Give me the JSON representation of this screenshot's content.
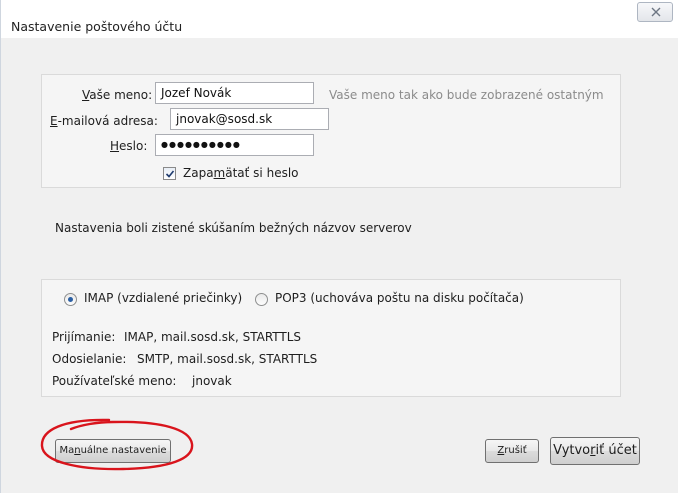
{
  "window": {
    "title": "Nastavenie poštového účtu",
    "close_label": "Close"
  },
  "account": {
    "name_label": "Vaše meno:",
    "name_value": "Jozef Novák",
    "name_hint": "Vaše meno tak ako bude zobrazené ostatným",
    "email_label": "E-mailová adresa:",
    "email_value": "jnovak@sosd.sk",
    "password_label": "Heslo:",
    "password_mask": "●●●●●●●●●●",
    "remember_label": "Zapamätať si heslo",
    "remember_checked": true
  },
  "status": {
    "message": "Nastavenia boli zistené skúšaním bežných názvov serverov"
  },
  "server": {
    "protocol_options": [
      {
        "label": "IMAP (vzdialené priečinky)",
        "selected": true
      },
      {
        "label": "POP3 (uchováva poštu na disku počítača)",
        "selected": false
      }
    ],
    "incoming_label": "Prijímanie:",
    "incoming_value": "IMAP, mail.sosd.sk, STARTTLS",
    "outgoing_label": "Odosielanie:",
    "outgoing_value": "SMTP, mail.sosd.sk, STARTTLS",
    "username_label": "Používateľské meno:",
    "username_value": "jnovak"
  },
  "buttons": {
    "manual_setup": "Manuálne nastavenie",
    "cancel": "Zrušiť",
    "create_account": "Vytvoriť účet"
  },
  "colors": {
    "annotation_ring": "#d9141c",
    "radio_dot": "#2b5fa3"
  },
  "icons": {
    "close": "close-x-icon",
    "checkbox": "checkmark-icon"
  }
}
